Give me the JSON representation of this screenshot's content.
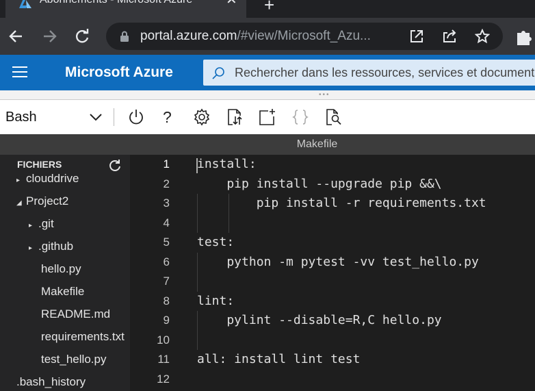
{
  "browser": {
    "tab_title": "Abonnements - Microsoft Azure",
    "close_glyph": "✕",
    "new_tab_glyph": "+",
    "url_host": "portal.azure.com",
    "url_path": "/#view/Microsoft_Azu..."
  },
  "azure": {
    "title": "Microsoft Azure",
    "search_placeholder": "Rechercher dans les ressources, services et documents"
  },
  "shell": {
    "selected": "Bash",
    "help_glyph": "?",
    "icons": [
      "power-icon",
      "help-icon",
      "settings-icon",
      "upload-download-icon",
      "new-session-icon",
      "braces-icon",
      "web-preview-icon"
    ]
  },
  "editor": {
    "file_name": "Makefile",
    "explorer_title": "FICHIERS",
    "tree": [
      {
        "label": "clouddrive",
        "indent": 1,
        "twisty": "▸"
      },
      {
        "label": "Project2",
        "indent": 1,
        "twisty": "◢"
      },
      {
        "label": ".git",
        "indent": 2,
        "twisty": "▸"
      },
      {
        "label": ".github",
        "indent": 2,
        "twisty": "▸"
      },
      {
        "label": "hello.py",
        "indent": 3,
        "twisty": ""
      },
      {
        "label": "Makefile",
        "indent": 3,
        "twisty": ""
      },
      {
        "label": "README.md",
        "indent": 3,
        "twisty": ""
      },
      {
        "label": "requirements.txt",
        "indent": 3,
        "twisty": ""
      },
      {
        "label": "test_hello.py",
        "indent": 3,
        "twisty": ""
      },
      {
        "label": ".bash_history",
        "indent": 1,
        "twisty": ""
      }
    ],
    "lines": [
      {
        "n": "1",
        "text": "install:"
      },
      {
        "n": "2",
        "text": "    pip install --upgrade pip &&\\"
      },
      {
        "n": "3",
        "text": "        pip install -r requirements.txt"
      },
      {
        "n": "4",
        "text": ""
      },
      {
        "n": "5",
        "text": "test:"
      },
      {
        "n": "6",
        "text": "    python -m pytest -vv test_hello.py"
      },
      {
        "n": "7",
        "text": ""
      },
      {
        "n": "8",
        "text": "lint:"
      },
      {
        "n": "9",
        "text": "    pylint --disable=R,C hello.py"
      },
      {
        "n": "10",
        "text": ""
      },
      {
        "n": "11",
        "text": "all: install lint test"
      },
      {
        "n": "12",
        "text": ""
      }
    ]
  },
  "colors": {
    "azure_blue": "#0f6cbd",
    "editor_bg": "#1e1e1e",
    "explorer_bg": "#252526"
  }
}
